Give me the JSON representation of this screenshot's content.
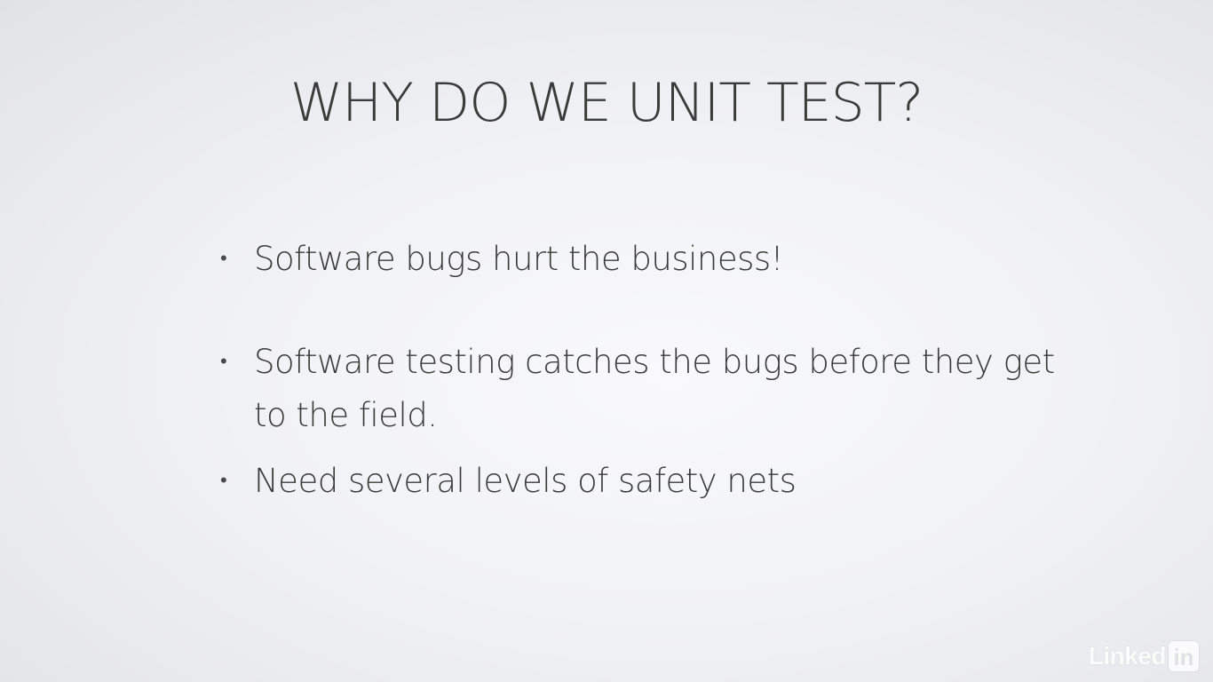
{
  "slide": {
    "title": "WHY DO WE UNIT TEST?",
    "bullets": [
      "Software bugs hurt the business!",
      "Software testing catches the bugs before they get to the field.",
      "Need several levels of safety nets"
    ]
  },
  "watermark": {
    "word": "Linked",
    "box": "in"
  },
  "colors": {
    "text": "#3b3b3b",
    "background": "#f1f2f5"
  }
}
